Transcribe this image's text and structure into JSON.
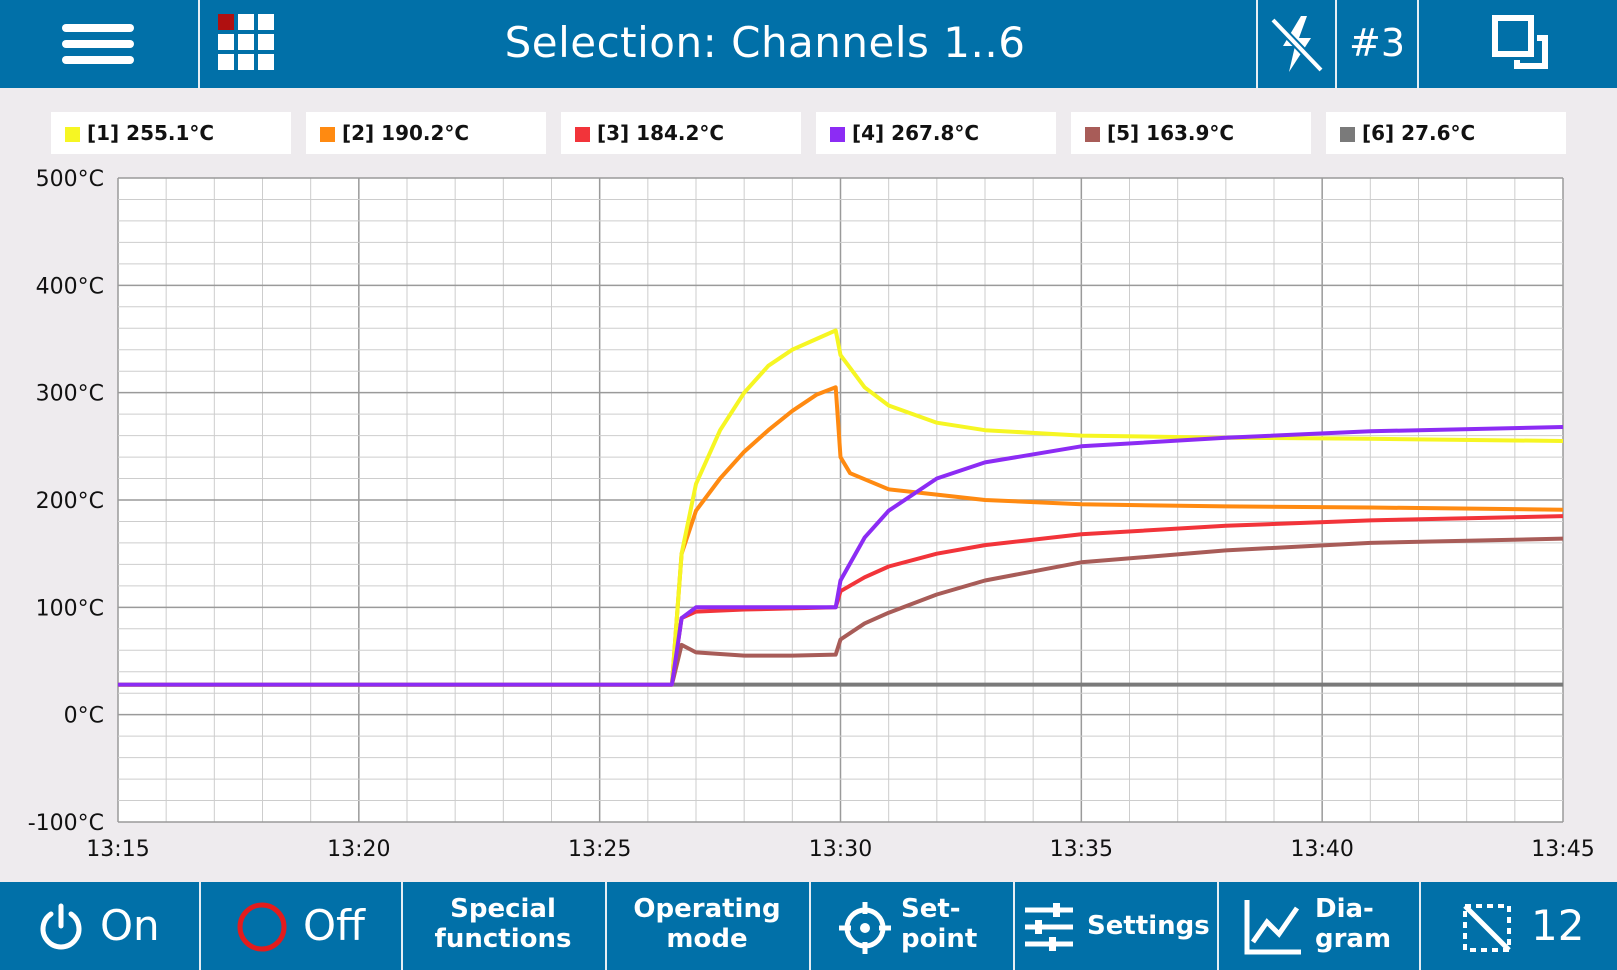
{
  "header": {
    "title": "Selection: Channels 1..6",
    "slot_label": "#3"
  },
  "legend": [
    {
      "label": "[1] 255.1°C",
      "color": "#f6f623"
    },
    {
      "label": "[2] 190.2°C",
      "color": "#ff8a11"
    },
    {
      "label": "[3] 184.2°C",
      "color": "#f2343a"
    },
    {
      "label": "[4] 267.8°C",
      "color": "#8c2cf4"
    },
    {
      "label": "[5] 163.9°C",
      "color": "#a85c58"
    },
    {
      "label": "[6] 27.6°C",
      "color": "#7a7a7a"
    }
  ],
  "chart_data": {
    "type": "line",
    "x_unit": "time",
    "x_range": [
      "13:15",
      "13:45"
    ],
    "x_ticks": [
      "13:15",
      "13:20",
      "13:25",
      "13:30",
      "13:35",
      "13:40",
      "13:45"
    ],
    "y_ticks": [
      "500°C",
      "400°C",
      "300°C",
      "200°C",
      "100°C",
      "0°C",
      "-100°C"
    ],
    "ylim": [
      -100,
      500
    ],
    "grid": true,
    "series": [
      {
        "name": "[1]",
        "color": "#f6f623",
        "x": [
          "13:15",
          "13:26.5",
          "13:26.7",
          "13:27",
          "13:27.5",
          "13:28",
          "13:28.5",
          "13:29",
          "13:29.5",
          "13:29.9",
          "13:30",
          "13:30.5",
          "13:31",
          "13:32",
          "13:33",
          "13:35",
          "13:38",
          "13:41",
          "13:45"
        ],
        "y": [
          28,
          28,
          150,
          215,
          265,
          300,
          325,
          340,
          350,
          358,
          335,
          305,
          288,
          272,
          265,
          260,
          258,
          257,
          255
        ]
      },
      {
        "name": "[2]",
        "color": "#ff8a11",
        "x": [
          "13:15",
          "13:26.5",
          "13:26.7",
          "13:27",
          "13:27.5",
          "13:28",
          "13:28.5",
          "13:29",
          "13:29.5",
          "13:29.9",
          "13:30",
          "13:30.2",
          "13:31",
          "13:32",
          "13:33",
          "13:35",
          "13:38",
          "13:41",
          "13:45"
        ],
        "y": [
          28,
          28,
          150,
          190,
          220,
          245,
          265,
          283,
          298,
          305,
          240,
          225,
          210,
          205,
          200,
          196,
          194,
          193,
          191
        ]
      },
      {
        "name": "[3]",
        "color": "#f2343a",
        "x": [
          "13:15",
          "13:26.5",
          "13:26.7",
          "13:27",
          "13:28",
          "13:29",
          "13:29.9",
          "13:30",
          "13:30.5",
          "13:31",
          "13:32",
          "13:33",
          "13:35",
          "13:38",
          "13:41",
          "13:45"
        ],
        "y": [
          28,
          28,
          90,
          96,
          98,
          99,
          100,
          115,
          128,
          138,
          150,
          158,
          168,
          176,
          181,
          185
        ]
      },
      {
        "name": "[4]",
        "color": "#8c2cf4",
        "x": [
          "13:15",
          "13:26.5",
          "13:26.7",
          "13:27",
          "13:28",
          "13:29",
          "13:29.9",
          "13:30",
          "13:30.5",
          "13:31",
          "13:32",
          "13:33",
          "13:35",
          "13:38",
          "13:41",
          "13:45"
        ],
        "y": [
          28,
          28,
          90,
          100,
          100,
          100,
          100,
          125,
          165,
          190,
          220,
          235,
          250,
          258,
          264,
          268
        ]
      },
      {
        "name": "[5]",
        "color": "#a85c58",
        "x": [
          "13:15",
          "13:26.5",
          "13:26.7",
          "13:27",
          "13:28",
          "13:29",
          "13:29.9",
          "13:30",
          "13:30.5",
          "13:31",
          "13:32",
          "13:33",
          "13:35",
          "13:38",
          "13:41",
          "13:45"
        ],
        "y": [
          28,
          28,
          65,
          58,
          55,
          55,
          56,
          70,
          85,
          95,
          112,
          125,
          142,
          153,
          160,
          164
        ]
      },
      {
        "name": "[6]",
        "color": "#7a7a7a",
        "x": [
          "13:15",
          "13:20",
          "13:25",
          "13:30",
          "13:35",
          "13:40",
          "13:45"
        ],
        "y": [
          28,
          28,
          28,
          28,
          28,
          28,
          28
        ]
      }
    ]
  },
  "footer": {
    "on": {
      "label": "On",
      "icon": "power-icon"
    },
    "off": {
      "label": "Off",
      "icon": "ring-icon"
    },
    "special": {
      "label": "Special\nfunctions"
    },
    "operating": {
      "label": "Operating\nmode"
    },
    "setpoint": {
      "label": "Set-\npoint",
      "icon": "crosshair-icon"
    },
    "settings": {
      "label": "Settings",
      "icon": "sliders-icon"
    },
    "diagram": {
      "label": "Dia-\ngram",
      "icon": "line-chart-icon"
    },
    "zoom": {
      "label": "12",
      "icon": "zoom-reset-icon"
    }
  }
}
